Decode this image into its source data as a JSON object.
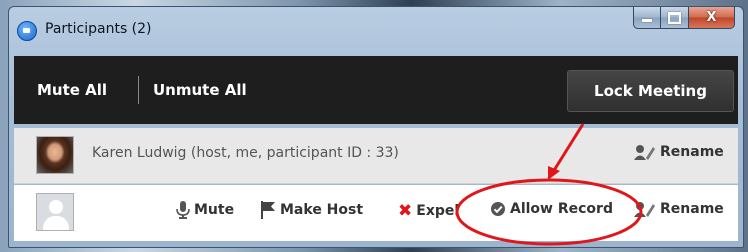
{
  "window": {
    "title": "Participants (2)",
    "close_glyph": "X"
  },
  "toolbar": {
    "mute_all": "Mute All",
    "unmute_all": "Unmute All",
    "lock_meeting": "Lock Meeting"
  },
  "participants": [
    {
      "name": "Karen Ludwig (host, me, participant ID : 33)",
      "avatar": "photo",
      "actions": [
        {
          "label": "Rename",
          "icon": "rename-icon"
        }
      ]
    },
    {
      "name": "",
      "avatar": "blank-avatar",
      "actions": [
        {
          "label": "Mute",
          "icon": "microphone-icon"
        },
        {
          "label": "Make Host",
          "icon": "flag-icon"
        },
        {
          "label": "Expel",
          "icon": "x-icon"
        },
        {
          "label": "Allow Record",
          "icon": "check-circle-icon"
        },
        {
          "label": "Rename",
          "icon": "rename-icon"
        }
      ]
    }
  ],
  "annotation": {
    "color": "#e0161a"
  }
}
